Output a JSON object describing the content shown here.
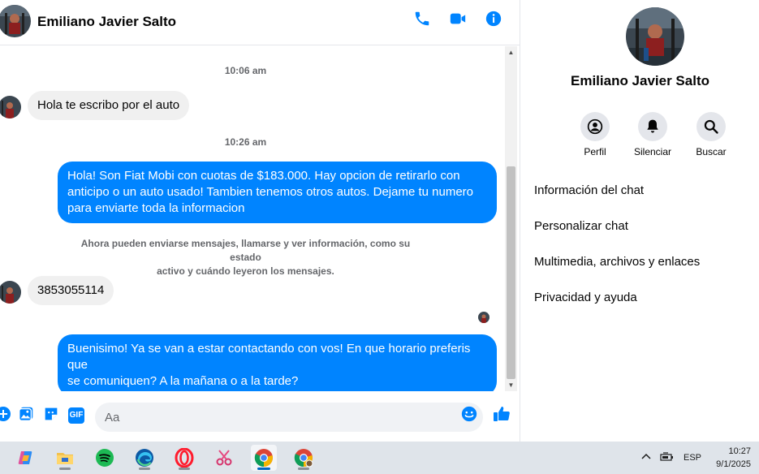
{
  "header": {
    "contact_name": "Emiliano Javier Salto",
    "icons": [
      "phone-icon",
      "video-icon",
      "info-icon"
    ],
    "accent": "#0084ff"
  },
  "messages": {
    "timestamp_1": "10:06 am",
    "incoming_1": "Hola te escribo por el auto",
    "timestamp_2": "10:26 am",
    "outgoing_1_line1": "Hola! Son Fiat Mobi con cuotas de $183.000. Hay opcion de retirarlo con",
    "outgoing_1_line2": "anticipo o un auto usado! Tambien tenemos otros autos. Dejame tu numero",
    "outgoing_1_line3": "para enviarte toda la informacion",
    "system_note_line1": "Ahora pueden enviarse mensajes, llamarse y ver información, como su estado",
    "system_note_line2": "activo y cuándo leyeron los mensajes.",
    "incoming_2": "3853055114",
    "outgoing_2_line1": "Buenisimo! Ya se van a estar contactando con vos! En que horario preferis que",
    "outgoing_2_line2": "se comuniquen? A la mañana o a la tarde?"
  },
  "composer": {
    "placeholder": "Aa",
    "icons": [
      "plus-icon",
      "image-icon",
      "sticker-icon",
      "gif-icon",
      "emoji-icon",
      "like-icon"
    ],
    "gif_label": "GIF"
  },
  "right_panel": {
    "name": "Emiliano Javier Salto",
    "actions": [
      {
        "label": "Perfil",
        "icon": "profile-icon"
      },
      {
        "label": "Silenciar",
        "icon": "bell-icon"
      },
      {
        "label": "Buscar",
        "icon": "search-icon"
      }
    ],
    "menu": [
      "Información del chat",
      "Personalizar chat",
      "Multimedia, archivos y enlaces",
      "Privacidad y ayuda"
    ]
  },
  "taskbar": {
    "apps": [
      "copilot-icon",
      "file-explorer-icon",
      "spotify-icon",
      "edge-icon",
      "opera-icon",
      "snipping-tool-icon",
      "chrome-icon",
      "chrome-profile-icon"
    ],
    "language": "ESP",
    "time": "10:27",
    "date": "9/1/2025"
  }
}
